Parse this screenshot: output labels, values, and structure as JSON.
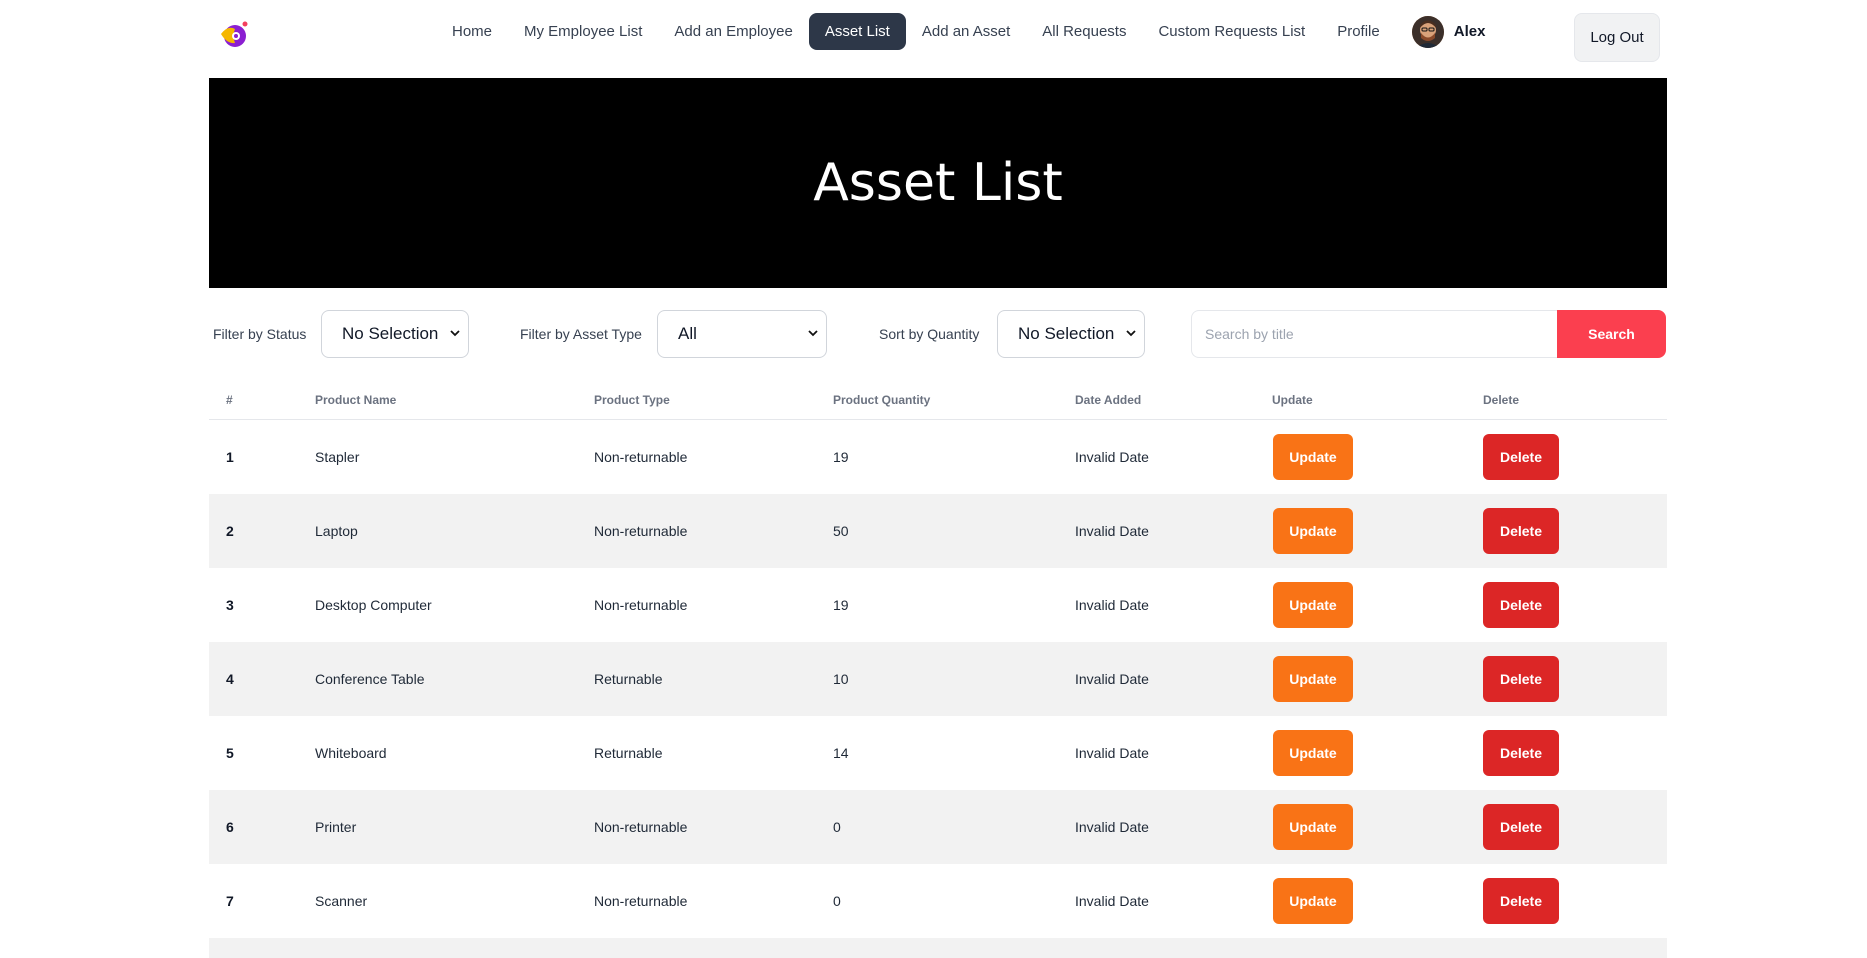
{
  "nav": {
    "links": [
      {
        "label": "Home",
        "active": false
      },
      {
        "label": "My Employee List",
        "active": false
      },
      {
        "label": "Add an Employee",
        "active": false
      },
      {
        "label": "Asset List",
        "active": true
      },
      {
        "label": "Add an Asset",
        "active": false
      },
      {
        "label": "All Requests",
        "active": false
      },
      {
        "label": "Custom Requests List",
        "active": false
      },
      {
        "label": "Profile",
        "active": false
      }
    ],
    "user_name": "Alex",
    "logout_label": "Log Out"
  },
  "banner": {
    "title": "Asset List"
  },
  "filters": {
    "status_label": "Filter by Status",
    "status_value": "No Selection",
    "type_label": "Filter by Asset Type",
    "type_value": "All",
    "sort_label": "Sort by Quantity",
    "sort_value": "No Selection",
    "search_placeholder": "Search by title",
    "search_button": "Search"
  },
  "table": {
    "headers": [
      "#",
      "Product Name",
      "Product Type",
      "Product Quantity",
      "Date Added",
      "Update",
      "Delete"
    ],
    "update_label": "Update",
    "delete_label": "Delete",
    "rows": [
      [
        "1",
        "Stapler",
        "Non-returnable",
        "19",
        "Invalid Date"
      ],
      [
        "2",
        "Laptop",
        "Non-returnable",
        "50",
        "Invalid Date"
      ],
      [
        "3",
        "Desktop Computer",
        "Non-returnable",
        "19",
        "Invalid Date"
      ],
      [
        "4",
        "Conference Table",
        "Returnable",
        "10",
        "Invalid Date"
      ],
      [
        "5",
        "Whiteboard",
        "Returnable",
        "14",
        "Invalid Date"
      ],
      [
        "6",
        "Printer",
        "Non-returnable",
        "0",
        "Invalid Date"
      ],
      [
        "7",
        "Scanner",
        "Non-returnable",
        "0",
        "Invalid Date"
      ]
    ]
  },
  "colors": {
    "active_nav": "#2d3748",
    "search_button": "#fb3f4f",
    "update_button": "#f97316",
    "delete_button": "#dc2626",
    "banner": "#000000"
  },
  "icons": {
    "logo": "brand-logo-icon",
    "select_chevron": "chevron-down-icon"
  }
}
